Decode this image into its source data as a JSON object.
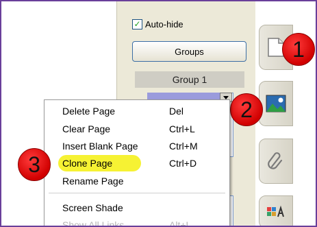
{
  "sidebar": {
    "auto_hide": {
      "label": "Auto-hide",
      "checked": true
    },
    "groups_button": "Groups",
    "group_header": "Group 1"
  },
  "context_menu": {
    "items": [
      {
        "label": "Delete Page",
        "shortcut": "Del"
      },
      {
        "label": "Clear Page",
        "shortcut": "Ctrl+L"
      },
      {
        "label": "Insert Blank Page",
        "shortcut": "Ctrl+M"
      },
      {
        "label": "Clone Page",
        "shortcut": "Ctrl+D",
        "highlighted": true
      },
      {
        "label": "Rename Page",
        "shortcut": ""
      },
      {
        "label": "Screen Shade",
        "shortcut": ""
      },
      {
        "label": "Show All Links",
        "shortcut": "Alt+L"
      }
    ]
  },
  "badges": [
    "1",
    "2",
    "3"
  ],
  "tabs": [
    {
      "icon": "page-icon"
    },
    {
      "icon": "gallery-icon"
    },
    {
      "icon": "paperclip-icon"
    },
    {
      "icon": "properties-icon"
    }
  ],
  "colors": {
    "frame": "#6a3f9a",
    "badge": "#e00000",
    "highlight": "#f6f233",
    "thumb_selected": "#9a9bdc"
  }
}
